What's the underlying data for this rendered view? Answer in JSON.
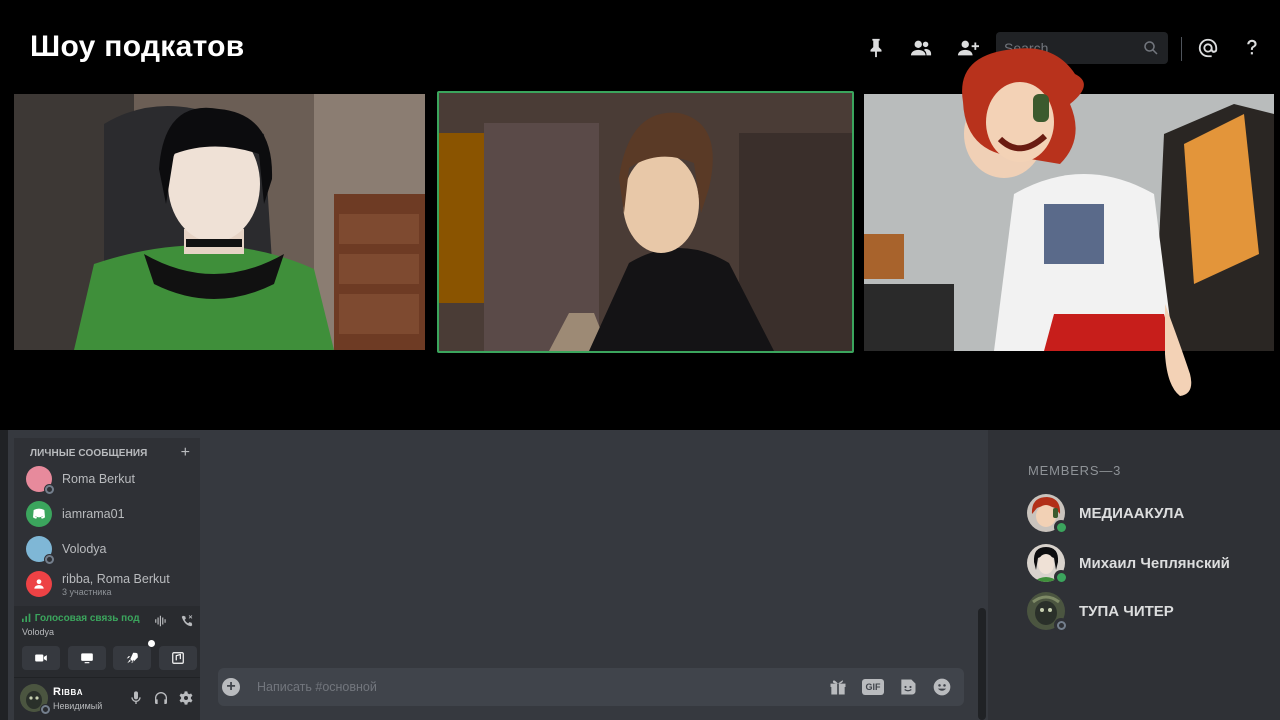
{
  "header": {
    "title": "Шоу подкатов",
    "search_placeholder": "Search"
  },
  "icons": {
    "pin": "pin-icon",
    "members": "members-icon",
    "add_member": "add-member-icon",
    "search": "search-icon",
    "mentions": "mention-icon",
    "help": "help-icon"
  },
  "direct_messages": {
    "header": "ЛИЧНЫЕ СООБЩЕНИЯ",
    "add_label": "+",
    "items": [
      {
        "name": "Roma Berkut",
        "sub": ""
      },
      {
        "name": "iamrama01",
        "sub": ""
      },
      {
        "name": "Volodya",
        "sub": ""
      },
      {
        "name": "ribba, Roma Berkut",
        "sub": "3 участника"
      }
    ]
  },
  "voice": {
    "status": "Голосовая связь под",
    "channel": "Volodya"
  },
  "user": {
    "name": "Ribba",
    "status": "Невидимый"
  },
  "composer": {
    "plus_label": "+",
    "placeholder": "Написать #основной",
    "gif_label": "GIF"
  },
  "members": {
    "title": "MEMBERS—3",
    "list": [
      {
        "name": "МЕДИААКУЛА",
        "status": "online"
      },
      {
        "name": "Михаил Чеплянский",
        "status": "online"
      },
      {
        "name": "ТУПА ЧИТЕР",
        "status": "offline"
      }
    ]
  },
  "colors": {
    "accent_green": "#3ba55d",
    "panel_dark": "#2f3136",
    "chat_bg": "#36393f",
    "input_bg": "#40444b"
  }
}
